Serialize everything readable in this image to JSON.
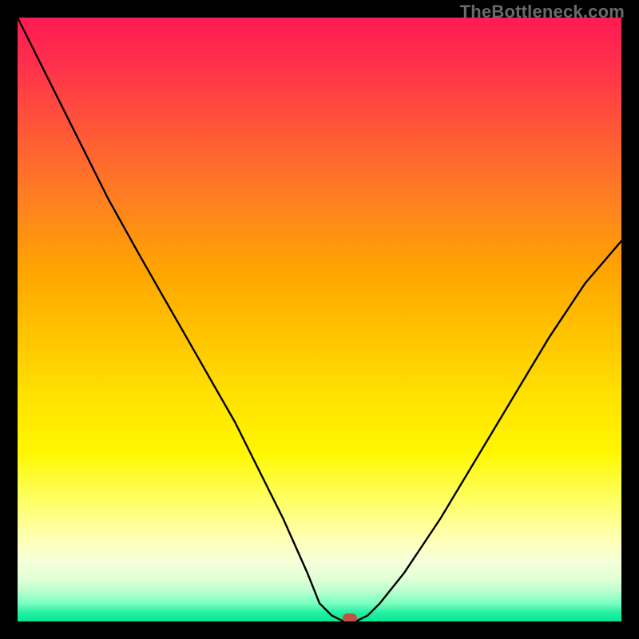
{
  "watermark": "TheBottleneck.com",
  "colors": {
    "frame": "#000000",
    "watermark_text": "#6a6a6a",
    "curve": "#000000",
    "marker": "#c35145",
    "gradient_top": "#ff1a53",
    "gradient_bottom": "#00e890"
  },
  "chart_data": {
    "type": "line",
    "title": "",
    "xlabel": "",
    "ylabel": "",
    "xlim": [
      0,
      100
    ],
    "ylim": [
      0,
      100
    ],
    "grid": false,
    "legend": false,
    "series": [
      {
        "name": "bottleneck-curve",
        "x": [
          0,
          5,
          10,
          15,
          20,
          24,
          28,
          32,
          36,
          40,
          44,
          48,
          50,
          52,
          54,
          55,
          56,
          58,
          60,
          64,
          70,
          76,
          82,
          88,
          94,
          100
        ],
        "values": [
          100,
          90,
          80,
          70,
          61,
          54,
          47,
          40,
          33,
          25,
          17,
          8,
          3,
          1,
          0,
          0,
          0,
          1,
          3,
          8,
          17,
          27,
          37,
          47,
          56,
          63
        ]
      }
    ],
    "marker": {
      "x": 55,
      "y": 0
    },
    "annotations": []
  }
}
